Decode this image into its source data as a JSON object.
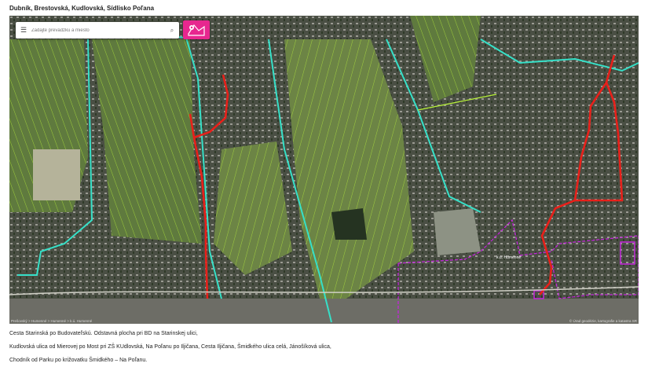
{
  "page": {
    "title": "Dubník, Brestovská, Kudlovská, Sídlisko Poľana"
  },
  "map": {
    "search": {
      "placeholder": "Zadajte prevádzku a miesto"
    },
    "icons": {
      "menu": "hamburger-menu-icon",
      "search": "search-icon",
      "layers": "map-pin-icon"
    },
    "breadcrumb": "Prešovský > Humenné > Humenné > k.ú. Humenné",
    "copyright": "© Úrad geodézie, kartografie a katastra SR",
    "area_label": "k.ú. Humenné",
    "colors": {
      "route": "#e8201a",
      "parcel": "#b8f23a",
      "boundary": "#36e0c8",
      "district": "#c326d9",
      "accent": "#e7278f"
    }
  },
  "body_text": {
    "line1": "Cesta Starinská po Budovateľskú. Odstavná plocha pri BD na Starinskej ulici,",
    "line2": "Kudlovská ulica od Mierovej po Most pri ZŠ KUdlovská, Na Poľanu po Iljičana, Cesta Iljičana, Šmidkého ulica celá, Jánošíková ulica,",
    "line3": "Chodník od Parku po križovatku Šmidkého – Na Poľanu."
  }
}
